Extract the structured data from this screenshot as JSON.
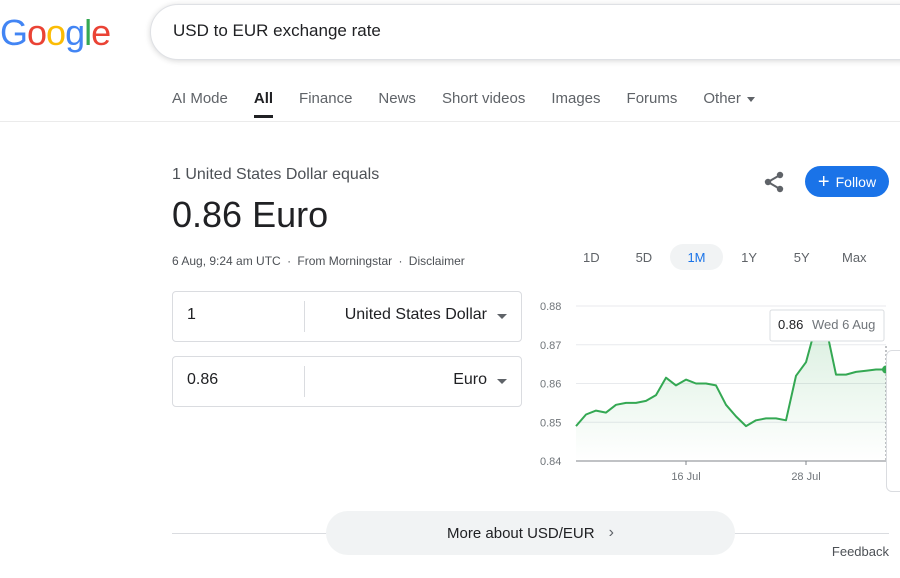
{
  "logo": {
    "letters": [
      {
        "ch": "G",
        "color": "#4285F4"
      },
      {
        "ch": "o",
        "color": "#EA4335"
      },
      {
        "ch": "o",
        "color": "#FBBC05"
      },
      {
        "ch": "g",
        "color": "#4285F4"
      },
      {
        "ch": "l",
        "color": "#34A853"
      },
      {
        "ch": "e",
        "color": "#EA4335"
      }
    ]
  },
  "search": {
    "query": "USD to EUR exchange rate"
  },
  "tabs": [
    {
      "label": "AI Mode"
    },
    {
      "label": "All",
      "active": true
    },
    {
      "label": "Finance"
    },
    {
      "label": "News"
    },
    {
      "label": "Short videos"
    },
    {
      "label": "Images"
    },
    {
      "label": "Forums"
    },
    {
      "label": "Other"
    }
  ],
  "converter": {
    "equals_label": "1 United States Dollar equals",
    "result": "0.86 Euro",
    "timestamp": "6 Aug, 9:24 am UTC",
    "separator": "·",
    "source": "From Morningstar",
    "disclaimer": "Disclaimer",
    "from": {
      "amount": "1",
      "currency": "United States Dollar"
    },
    "to": {
      "amount": "0.86",
      "currency": "Euro"
    }
  },
  "actions": {
    "follow_label": "Follow"
  },
  "ranges": [
    {
      "label": "1D"
    },
    {
      "label": "5D"
    },
    {
      "label": "1M",
      "active": true
    },
    {
      "label": "1Y"
    },
    {
      "label": "5Y"
    },
    {
      "label": "Max"
    }
  ],
  "chart_data": {
    "type": "line",
    "ylim": [
      0.84,
      0.88
    ],
    "yticks": [
      "0.88",
      "0.87",
      "0.86",
      "0.85",
      "0.84"
    ],
    "xticks": [
      {
        "label": "16 Jul",
        "x": 11
      },
      {
        "label": "28 Jul",
        "x": 23
      }
    ],
    "xrange": [
      0,
      31
    ],
    "line_color": "#34A853",
    "grid": true,
    "x": [
      0,
      1,
      2,
      3,
      4,
      5,
      6,
      7,
      8,
      9,
      10,
      11,
      12,
      13,
      14,
      15,
      16,
      17,
      18,
      19,
      20,
      21,
      22,
      23,
      24,
      25,
      26,
      27,
      28,
      29,
      30,
      31
    ],
    "values": [
      0.849,
      0.852,
      0.853,
      0.8525,
      0.8545,
      0.855,
      0.855,
      0.8555,
      0.857,
      0.8615,
      0.8595,
      0.861,
      0.86,
      0.86,
      0.8595,
      0.8545,
      0.8515,
      0.849,
      0.8505,
      0.851,
      0.851,
      0.8505,
      0.862,
      0.8655,
      0.875,
      0.8745,
      0.8623,
      0.8623,
      0.863,
      0.8633,
      0.8636,
      0.8636
    ],
    "tooltip": {
      "value": "0.86",
      "date": "Wed 6 Aug"
    }
  },
  "more_label": "More about USD/EUR",
  "feedback_label": "Feedback"
}
